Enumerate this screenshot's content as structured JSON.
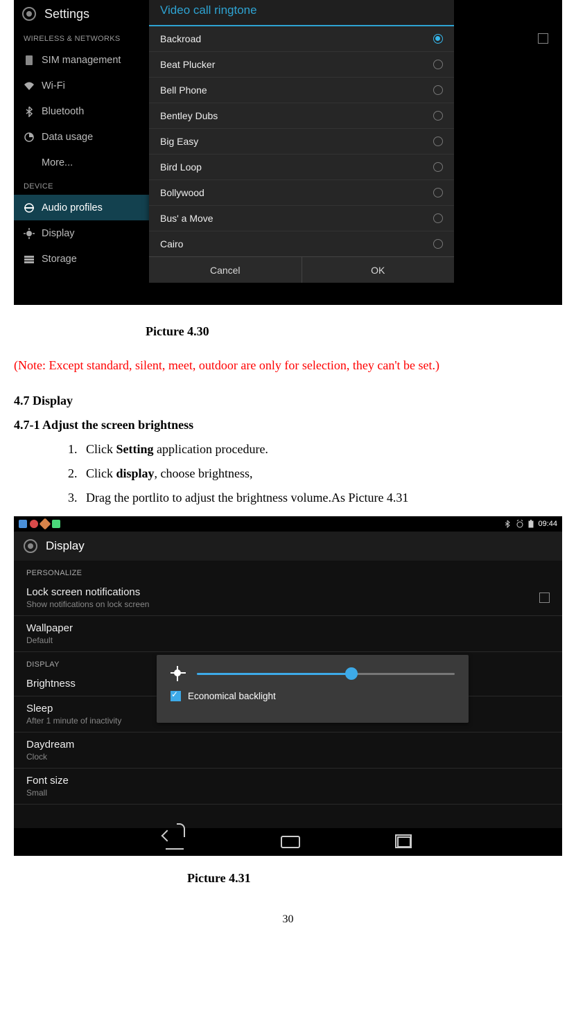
{
  "screenshot1": {
    "title": "Settings",
    "section1": "WIRELESS & NETWORKS",
    "sidebar_items": [
      {
        "label": "SIM management",
        "icon": "sim-icon"
      },
      {
        "label": "Wi-Fi",
        "icon": "wifi-icon"
      },
      {
        "label": "Bluetooth",
        "icon": "bluetooth-icon"
      },
      {
        "label": "Data usage",
        "icon": "datausage-icon"
      },
      {
        "label": "More...",
        "icon": ""
      }
    ],
    "section2": "DEVICE",
    "sidebar_items2": [
      {
        "label": "Audio profiles",
        "icon": "audio-icon",
        "selected": true
      },
      {
        "label": "Display",
        "icon": "display-icon"
      },
      {
        "label": "Storage",
        "icon": "storage-icon"
      }
    ],
    "dialog": {
      "title": "Video call ringtone",
      "options": [
        {
          "label": "Backroad",
          "selected": true
        },
        {
          "label": "Beat Plucker",
          "selected": false
        },
        {
          "label": "Bell Phone",
          "selected": false
        },
        {
          "label": "Bentley Dubs",
          "selected": false
        },
        {
          "label": "Big Easy",
          "selected": false
        },
        {
          "label": "Bird Loop",
          "selected": false
        },
        {
          "label": "Bollywood",
          "selected": false
        },
        {
          "label": "Bus' a Move",
          "selected": false
        },
        {
          "label": "Cairo",
          "selected": false
        }
      ],
      "cancel": "Cancel",
      "ok": "OK"
    }
  },
  "caption1": "Picture 4.30",
  "note": "(Note: Except standard, silent, meet, outdoor are only for selection, they can't be set.)",
  "h47": "4.7 Display",
  "h471": "4.7-1 Adjust the screen brightness",
  "steps": {
    "s1_pre": "Click ",
    "s1_b": "Setting",
    "s1_post": " application procedure.",
    "s2_pre": "Click ",
    "s2_b": "display",
    "s2_post": ", choose brightness,",
    "s3": "Drag the portlito to adjust the brightness volume.As Picture 4.31"
  },
  "screenshot2": {
    "time": "09:44",
    "title": "Display",
    "section1": "PERSONALIZE",
    "rows1": [
      {
        "t": "Lock screen notifications",
        "s": "Show notifications on lock screen",
        "checkbox": true
      },
      {
        "t": "Wallpaper",
        "s": "Default"
      }
    ],
    "section2": "DISPLAY",
    "rows2": [
      {
        "t": "Brightness",
        "s": ""
      },
      {
        "t": "Sleep",
        "s": "After 1 minute of inactivity"
      },
      {
        "t": "Daydream",
        "s": "Clock"
      },
      {
        "t": "Font size",
        "s": "Small"
      }
    ],
    "brightness_panel": {
      "label": "Economical backlight"
    }
  },
  "caption2": "Picture 4.31",
  "page_number": "30"
}
